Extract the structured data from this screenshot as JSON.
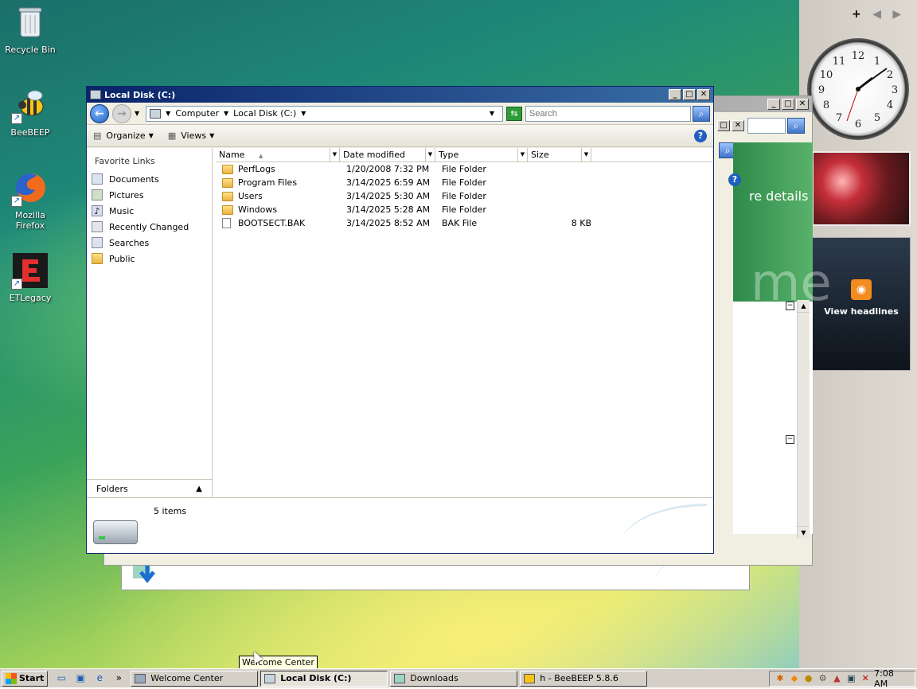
{
  "desktop": {
    "icons": [
      {
        "label": "Recycle Bin",
        "icon": "recycle-bin-icon"
      },
      {
        "label": "BeeBEEP",
        "icon": "bee-icon"
      },
      {
        "label": "Mozilla Firefox",
        "icon": "firefox-icon"
      },
      {
        "label": "ETLegacy",
        "icon": "etlegacy-icon"
      }
    ]
  },
  "sidebar": {
    "controls": {
      "add": "+",
      "prev": "◀",
      "next": "▶"
    },
    "feed_label": "View headlines"
  },
  "welcome_window": {
    "title": "",
    "details_text": "re details",
    "watermark_text": "me"
  },
  "downloads_window": {
    "title": "Downloads"
  },
  "explorer": {
    "title": "Local Disk (C:)",
    "address": {
      "crumbs": [
        "Computer",
        "Local Disk (C:)"
      ]
    },
    "search_placeholder": "Search",
    "toolbar": {
      "organize": "Organize",
      "views": "Views"
    },
    "nav": {
      "header": "Favorite Links",
      "links": [
        "Documents",
        "Pictures",
        "Music",
        "Recently Changed",
        "Searches",
        "Public"
      ],
      "folders_label": "Folders"
    },
    "columns": [
      "Name",
      "Date modified",
      "Type",
      "Size"
    ],
    "files": [
      {
        "name": "PerfLogs",
        "date": "1/20/2008 7:32 PM",
        "type": "File Folder",
        "size": "",
        "kind": "folder"
      },
      {
        "name": "Program Files",
        "date": "3/14/2025 6:59 AM",
        "type": "File Folder",
        "size": "",
        "kind": "folder"
      },
      {
        "name": "Users",
        "date": "3/14/2025 5:30 AM",
        "type": "File Folder",
        "size": "",
        "kind": "folder"
      },
      {
        "name": "Windows",
        "date": "3/14/2025 5:28 AM",
        "type": "File Folder",
        "size": "",
        "kind": "folder"
      },
      {
        "name": "BOOTSECT.BAK",
        "date": "3/14/2025 8:52 AM",
        "type": "BAK File",
        "size": "8 KB",
        "kind": "file"
      }
    ],
    "status": "5 items"
  },
  "taskbar": {
    "start_label": "Start",
    "overflow": "»",
    "tasks": [
      {
        "label": "Welcome Center",
        "active": false
      },
      {
        "label": "Local Disk (C:)",
        "active": true
      },
      {
        "label": "Downloads",
        "active": false
      },
      {
        "label": "h - BeeBEEP 5.8.6",
        "active": false
      }
    ],
    "clock": "7:08 AM"
  },
  "tooltip": "Welcome Center"
}
